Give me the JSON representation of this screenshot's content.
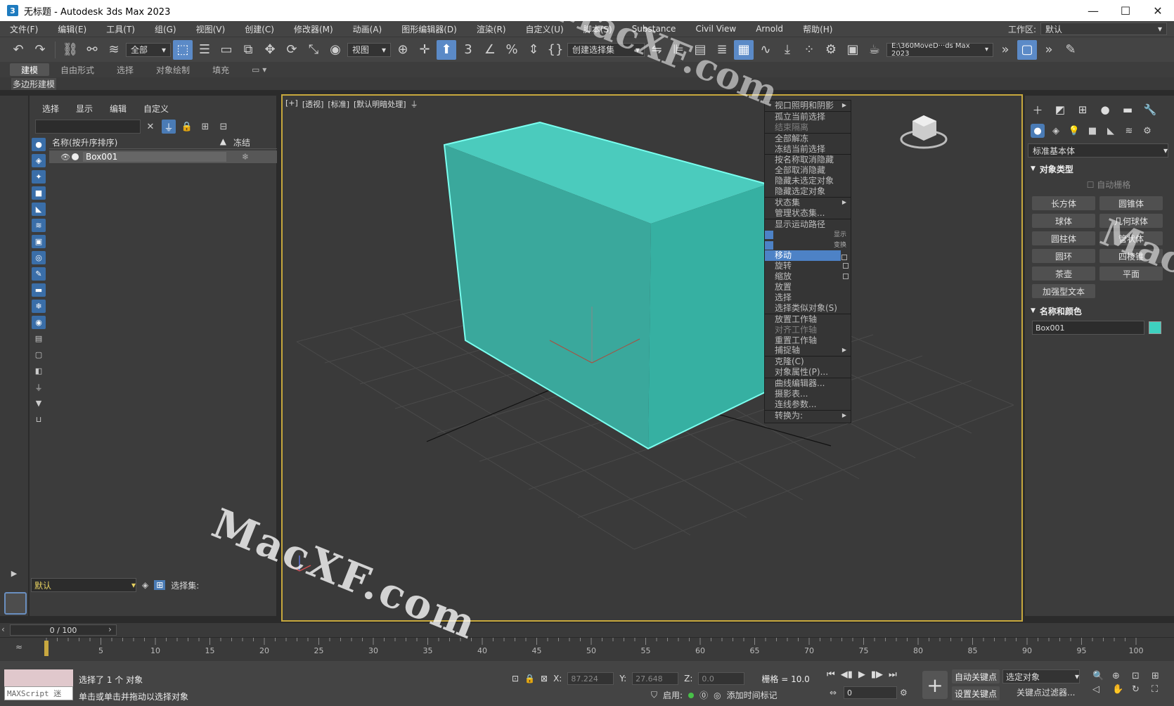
{
  "window": {
    "title": "无标题 - Autodesk 3ds Max 2023",
    "app_icon_glyph": "3"
  },
  "menu": [
    "文件(F)",
    "编辑(E)",
    "工具(T)",
    "组(G)",
    "视图(V)",
    "创建(C)",
    "修改器(M)",
    "动画(A)",
    "图形编辑器(D)",
    "渲染(R)",
    "自定义(U)",
    "脚本(S)",
    "Substance",
    "Civil View",
    "Arnold",
    "帮助(H)"
  ],
  "workspace": {
    "label": "工作区:",
    "value": "默认"
  },
  "toolbar": {
    "filter": "全部",
    "ref_coord": "视图",
    "selection_set": "创建选择集",
    "project_path": "E:\\360MoveD···ds Max 2023"
  },
  "ribbon": {
    "tabs": [
      "建模",
      "自由形式",
      "选择",
      "对象绘制",
      "填充"
    ],
    "active_tab": 0,
    "sub_label": "多边形建模"
  },
  "explorer": {
    "menu": [
      "选择",
      "显示",
      "编辑",
      "自定义"
    ],
    "col_name": "名称(按升序排序)",
    "col_freeze": "冻结",
    "rows": [
      {
        "name": "Box001"
      }
    ],
    "layer": "默认",
    "selection_set_label": "选择集:"
  },
  "viewport": {
    "labels": [
      "[+]",
      "[透视]",
      "[标准]",
      "[默认明暗处理]"
    ],
    "box_color": "#3ed0bf"
  },
  "quad_menu": {
    "group1": [
      {
        "label": "视口照明和阴影",
        "arrow": true,
        "disabled": false
      },
      {
        "label": "孤立当前选择",
        "disabled": false
      },
      {
        "label": "结束隔离",
        "disabled": true
      },
      {
        "label": "全部解冻",
        "disabled": false
      },
      {
        "label": "冻结当前选择",
        "disabled": false
      },
      {
        "label": "按名称取消隐藏",
        "disabled": false
      },
      {
        "label": "全部取消隐藏",
        "disabled": false
      },
      {
        "label": "隐藏未选定对象",
        "disabled": false
      },
      {
        "label": "隐藏选定对象",
        "disabled": false
      },
      {
        "label": "状态集",
        "arrow": true,
        "disabled": false
      },
      {
        "label": "管理状态集...",
        "disabled": false
      },
      {
        "label": "显示运动路径",
        "disabled": false
      }
    ],
    "label_display": "显示",
    "label_transform": "变换",
    "group2": [
      {
        "label": "移动",
        "selected": true,
        "box": true
      },
      {
        "label": "旋转",
        "box": true
      },
      {
        "label": "缩放",
        "box": true
      },
      {
        "label": "放置"
      },
      {
        "label": "选择"
      },
      {
        "label": "选择类似对象(S)"
      }
    ],
    "group3": [
      {
        "label": "放置工作轴"
      },
      {
        "label": "对齐工作轴",
        "disabled": true
      },
      {
        "label": "重置工作轴"
      },
      {
        "label": "捕捉轴",
        "arrow": true
      }
    ],
    "group4": [
      {
        "label": "克隆(C)"
      },
      {
        "label": "对象属性(P)..."
      }
    ],
    "group5": [
      {
        "label": "曲线编辑器..."
      },
      {
        "label": "摄影表..."
      },
      {
        "label": "连线参数..."
      }
    ],
    "group6": [
      {
        "label": "转换为:",
        "arrow": true
      }
    ]
  },
  "command_panel": {
    "category": "标准基本体",
    "object_type_title": "对象类型",
    "auto_grid": "自动栅格",
    "objects": [
      "长方体",
      "圆锥体",
      "球体",
      "几何球体",
      "圆柱体",
      "管状体",
      "圆环",
      "四棱锥",
      "茶壶",
      "平面",
      "加强型文本"
    ],
    "name_color_title": "名称和颜色",
    "object_name": "Box001",
    "object_color": "#3ed0bf"
  },
  "timeline": {
    "frame_display": "0 / 100",
    "ticks": [
      0,
      5,
      10,
      15,
      20,
      25,
      30,
      35,
      40,
      45,
      50,
      55,
      60,
      65,
      70,
      75,
      80,
      85,
      90,
      95,
      100
    ]
  },
  "status": {
    "maxscript": "MAXScript 迷",
    "selected_text": "选择了 1 个 对象",
    "prompt_text": "单击或单击并拖动以选择对象",
    "x_label": "X:",
    "x_value": "87.224",
    "y_label": "Y:",
    "y_value": "27.648",
    "z_label": "Z:",
    "z_value": "0.0",
    "grid_text": "栅格 = 10.0",
    "enable_label": "启用:",
    "add_time_tag": "添加时间标记",
    "frame_value": "0",
    "auto_key": "自动关键点",
    "set_key": "设置关键点",
    "key_target": "选定对象",
    "key_filter": "关键点过滤器..."
  },
  "watermark": "MacXF.com"
}
